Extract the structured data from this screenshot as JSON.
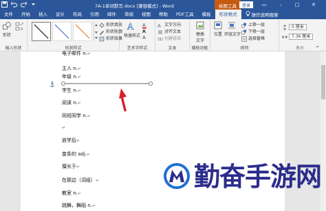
{
  "window": {
    "title": "7A-1单词默写.docx [兼容模式] - Word",
    "context_tab_group": "绘图工具",
    "login_label": "登录"
  },
  "tabs": [
    {
      "label": "文件"
    },
    {
      "label": "开始"
    },
    {
      "label": "插入"
    },
    {
      "label": "设计"
    },
    {
      "label": "布局"
    },
    {
      "label": "引用"
    },
    {
      "label": "邮件"
    },
    {
      "label": "审阅"
    },
    {
      "label": "视图"
    },
    {
      "label": "帮助"
    },
    {
      "label": "PDF工具"
    },
    {
      "label": "模板"
    },
    {
      "label": "形状格式"
    }
  ],
  "tell_me": "操作说明搜索",
  "ribbon": {
    "insert_shapes": {
      "shape_label": "形状",
      "group_label": "插入形状"
    },
    "shape_styles": {
      "fill": "形状填充",
      "outline": "形状轮廓",
      "effect": "形状效果",
      "group_label": "形状样式"
    },
    "wordart": {
      "quick_styles": "快速样式",
      "group_label": "艺术字样式"
    },
    "text": {
      "direction": "文字方向",
      "align": "对齐文本",
      "link": "创建链接",
      "group_label": "文本"
    },
    "accessibility": {
      "alt_text_line1": "替换",
      "alt_text_line2": "文字",
      "group_label": "辅助功能"
    },
    "arrange": {
      "position": "位置",
      "wrap": "环绕文字",
      "bring_forward": "上移一层",
      "send_backward": "下移一层",
      "selection_pane": "选择窗格",
      "group_label": "排列"
    },
    "size": {
      "height": "0 厘米",
      "width": "7.36 厘米",
      "group_label": "大小"
    }
  },
  "document": {
    "lines": [
      {
        "text": "电子邮件 n."
      },
      {
        "text": "主人 n."
      },
      {
        "text": "年级 n."
      },
      {
        "text": "学生 n."
      },
      {
        "text": "阅读 n."
      },
      {
        "text": "同班同学 n."
      },
      {
        "text": ""
      },
      {
        "text": "放学后"
      },
      {
        "text": "苗条的 adj."
      },
      {
        "text": "擅长于"
      },
      {
        "text": "在那边（词组）"
      },
      {
        "text": "教室 n."
      },
      {
        "text": "跳舞，舞蹈 n."
      }
    ],
    "paragraph_mark": "↵"
  },
  "watermark": {
    "text": "勤奋手游网"
  },
  "colors": {
    "accent": "#2b579a",
    "context": "#c55a11",
    "arrow": "#d9202a",
    "watermark": "#2c2c8c"
  }
}
